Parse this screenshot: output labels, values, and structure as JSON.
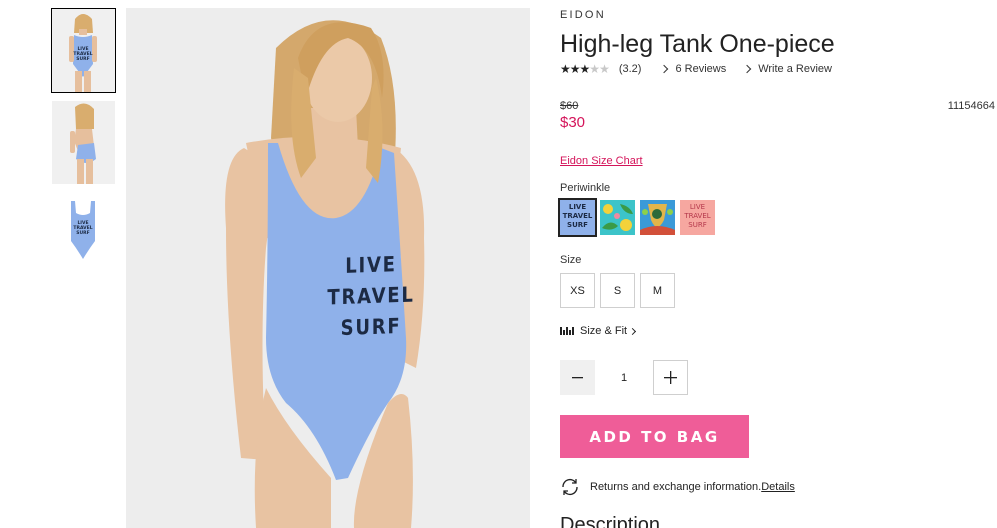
{
  "product": {
    "brand": "EIDON",
    "title": "High-leg Tank One-piece",
    "rating": {
      "stars_filled": 3,
      "stars_total": 5,
      "value_text": "(3.2)"
    },
    "reviews_label": "6 Reviews",
    "write_review_label": "Write a Review",
    "old_price": "$60",
    "new_price": "$30",
    "sku": "11154664",
    "size_chart_label": "Eidon Size Chart",
    "color_name": "Periwinkle",
    "swatches": [
      {
        "name": "periwinkle",
        "color": "#8fb1ea",
        "lines": [
          "LIVE",
          "TRAVEL",
          "SURF"
        ],
        "text_color": "#1c2a44",
        "selected": true
      },
      {
        "name": "tropical-print",
        "color": "#3cc4c9",
        "lines": [],
        "selected": false
      },
      {
        "name": "multicolor-print",
        "color": "#3a9ad8",
        "lines": [],
        "selected": false
      },
      {
        "name": "coral",
        "color": "#f6a7a0",
        "lines": [
          "LIVE",
          "TRAVEL",
          "SURF"
        ],
        "text_color": "#b4374a",
        "selected": false
      }
    ],
    "size_label": "Size",
    "sizes": [
      "XS",
      "S",
      "M"
    ],
    "size_fit_label": "Size & Fit",
    "quantity": "1",
    "add_to_bag_label": "ADD TO BAG",
    "returns_text": "Returns and exchange information.",
    "details_label": "Details",
    "description_heading": "Description"
  },
  "image": {
    "print_lines": [
      "LIVE",
      "TRAVEL",
      "SURF"
    ]
  },
  "colors": {
    "accent_pink": "#ef5d98",
    "sale_red": "#d4145a",
    "suit_blue": "#8fb1ea"
  },
  "icons": {
    "returns": "refresh-icon",
    "ruler": "ruler-icon",
    "star": "star-icon"
  }
}
